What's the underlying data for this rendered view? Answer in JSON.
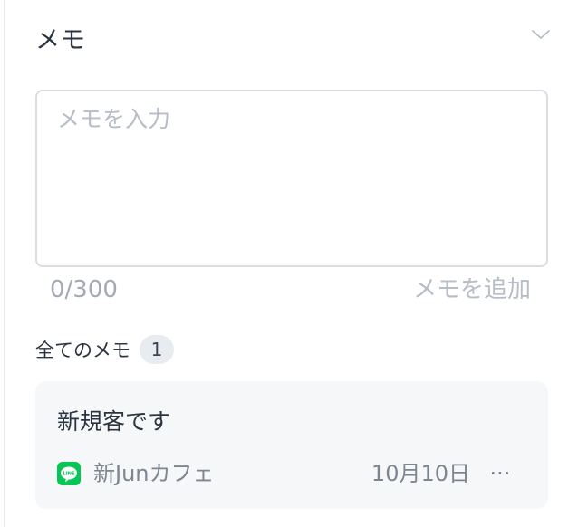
{
  "header": {
    "title": "メモ",
    "toggle_icon": "chevron-down-icon"
  },
  "memo_input": {
    "value": "",
    "placeholder": "メモを入力",
    "counter": "0/300",
    "add_label": "メモを追加"
  },
  "memo_list": {
    "label": "全てのメモ",
    "count": "1",
    "items": [
      {
        "text": "新規客です",
        "source_icon": "line-icon",
        "source_icon_text": "LINE",
        "source": "新Junカフェ",
        "date": "10月10日",
        "more_label": "···"
      }
    ]
  },
  "colors": {
    "line_green": "#06c755",
    "text_primary": "#2b3440",
    "text_muted": "#7d8590",
    "placeholder": "#b7bdc6",
    "card_background": "#f6f7f9"
  }
}
